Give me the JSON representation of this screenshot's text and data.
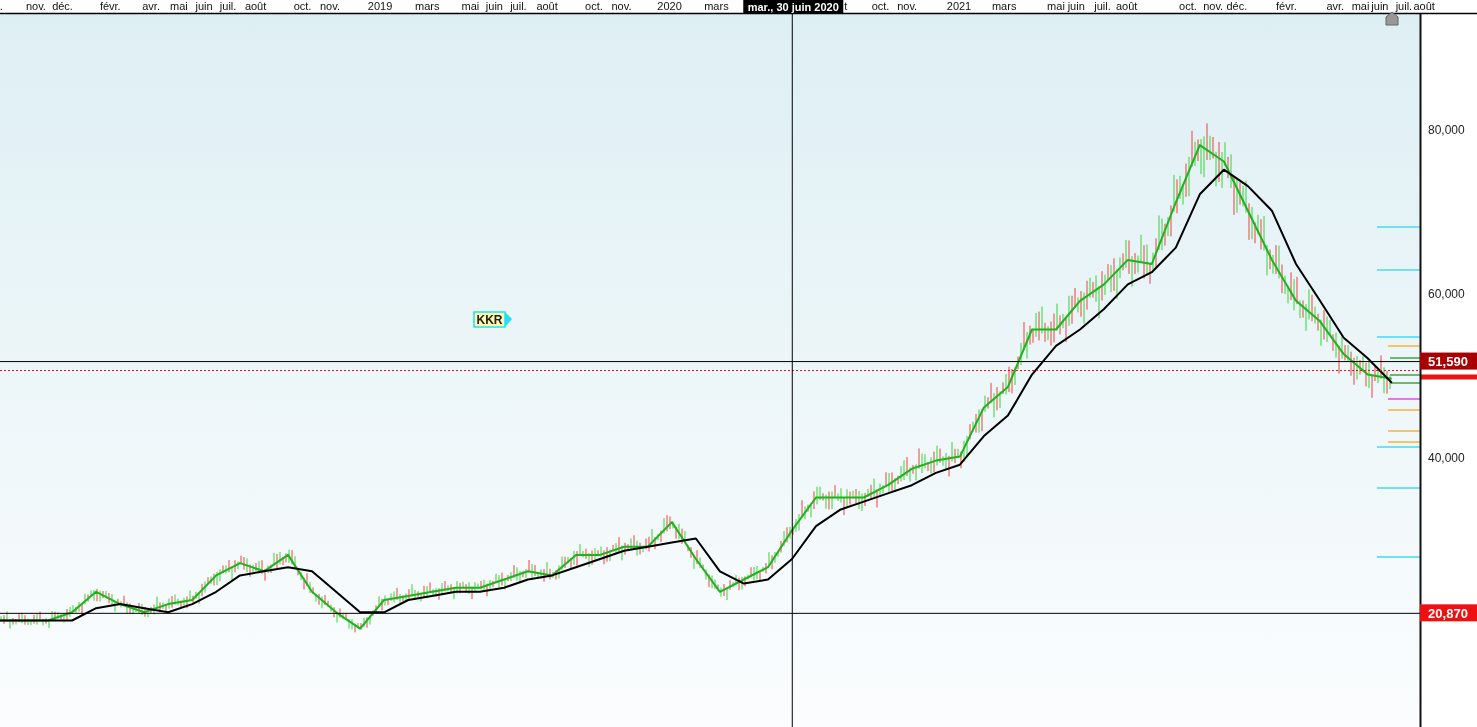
{
  "chart": {
    "chart_data": {
      "type": "line",
      "x": [
        2017.687,
        2017.77,
        2017.853,
        2017.936,
        2018.019,
        2018.102,
        2018.185,
        2018.268,
        2018.351,
        2018.434,
        2018.516,
        2018.599,
        2018.682,
        2018.765,
        2018.848,
        2018.931,
        2019.014,
        2019.097,
        2019.179,
        2019.262,
        2019.345,
        2019.428,
        2019.511,
        2019.594,
        2019.677,
        2019.76,
        2019.843,
        2019.925,
        2020.008,
        2020.091,
        2020.174,
        2020.257,
        2020.34,
        2020.423,
        2020.506,
        2020.589,
        2020.671,
        2020.754,
        2020.837,
        2020.92,
        2021.003,
        2021.086,
        2021.169,
        2021.252,
        2021.335,
        2021.418,
        2021.501,
        2021.583,
        2021.666,
        2021.749,
        2021.832,
        2021.915,
        2021.998,
        2022.081,
        2022.164,
        2022.247,
        2022.329,
        2022.412,
        2022.495
      ],
      "xlim": [
        2017.687,
        2022.786
      ],
      "ylim": [
        7000,
        94000
      ],
      "series": [
        {
          "color": "#1db31d",
          "values": [
            20000,
            20000,
            20000,
            21000,
            23500,
            22000,
            21000,
            22000,
            22500,
            25500,
            27000,
            26000,
            28000,
            23500,
            21000,
            19000,
            22500,
            23000,
            23500,
            24000,
            24000,
            25000,
            26000,
            25500,
            28000,
            28000,
            29000,
            29000,
            32000,
            27500,
            23500,
            25000,
            26500,
            31000,
            35000,
            35000,
            35000,
            36500,
            38500,
            39500,
            40000,
            46000,
            48500,
            55500,
            55500,
            59000,
            61000,
            64000,
            63500,
            71000,
            78000,
            76000,
            70000,
            64000,
            59000,
            56500,
            52500,
            50000,
            49500
          ]
        },
        {
          "color": "#000000",
          "values": [
            20000,
            20000,
            20000,
            20000,
            21500,
            22000,
            21500,
            21000,
            22000,
            23500,
            25500,
            26000,
            26500,
            26000,
            23500,
            21000,
            21000,
            22500,
            23000,
            23500,
            23500,
            24000,
            25000,
            25500,
            26500,
            27500,
            28500,
            29000,
            29500,
            30000,
            26000,
            24500,
            25000,
            27500,
            31500,
            33500,
            34500,
            35500,
            36500,
            38000,
            39000,
            42500,
            45000,
            50000,
            53500,
            55500,
            58000,
            61000,
            62500,
            65500,
            72000,
            75000,
            73000,
            70000,
            63500,
            59000,
            54500,
            52000,
            49000
          ]
        }
      ],
      "xticks": [
        {
          "value": 2017.691,
          "label": "."
        },
        {
          "value": 2017.811,
          "label": "nov."
        },
        {
          "value": 2017.903,
          "label": "déc."
        },
        {
          "value": 2018.068,
          "label": "févr."
        },
        {
          "value": 2018.209,
          "label": "avr."
        },
        {
          "value": 2018.305,
          "label": "mai"
        },
        {
          "value": 2018.392,
          "label": "juin"
        },
        {
          "value": 2018.475,
          "label": "juil."
        },
        {
          "value": 2018.57,
          "label": "août"
        },
        {
          "value": 2018.732,
          "label": "oct."
        },
        {
          "value": 2018.827,
          "label": "nov."
        },
        {
          "value": 2019,
          "label": "2019"
        },
        {
          "value": 2019.163,
          "label": "mars"
        },
        {
          "value": 2019.312,
          "label": "mai"
        },
        {
          "value": 2019.395,
          "label": "juin"
        },
        {
          "value": 2019.478,
          "label": "juil."
        },
        {
          "value": 2019.577,
          "label": "août"
        },
        {
          "value": 2019.739,
          "label": "oct."
        },
        {
          "value": 2019.834,
          "label": "nov."
        },
        {
          "value": 2020,
          "label": "2020"
        },
        {
          "value": 2020.162,
          "label": "mars"
        },
        {
          "value": 2020.609,
          "label": "t"
        },
        {
          "value": 2020.729,
          "label": "oct."
        },
        {
          "value": 2020.821,
          "label": "nov."
        },
        {
          "value": 2021,
          "label": "2021"
        },
        {
          "value": 2021.156,
          "label": "mars"
        },
        {
          "value": 2021.335,
          "label": "mai"
        },
        {
          "value": 2021.405,
          "label": "juin"
        },
        {
          "value": 2021.496,
          "label": "juil."
        },
        {
          "value": 2021.579,
          "label": "août"
        },
        {
          "value": 2021.791,
          "label": "oct."
        },
        {
          "value": 2021.878,
          "label": "nov."
        },
        {
          "value": 2021.96,
          "label": "déc."
        },
        {
          "value": 2022.131,
          "label": "févr."
        },
        {
          "value": 2022.3,
          "label": "avr."
        },
        {
          "value": 2022.387,
          "label": "mai"
        },
        {
          "value": 2022.454,
          "label": "juin"
        },
        {
          "value": 2022.537,
          "label": "juil."
        },
        {
          "value": 2022.607,
          "label": "août"
        }
      ],
      "yticks": [
        {
          "value": 80000,
          "label": "80,000"
        },
        {
          "value": 60000,
          "label": "60,000"
        },
        {
          "value": 40000,
          "label": "40,000"
        }
      ],
      "ref_lines": [
        {
          "axis": "y",
          "value": 51590,
          "color": "#000000"
        },
        {
          "axis": "y",
          "value": 20870,
          "color": "#000000"
        },
        {
          "axis": "y",
          "value": 50500,
          "color": "#ee1111"
        },
        {
          "axis": "x",
          "value": 2020.424,
          "color": "#000000"
        }
      ]
    }
  },
  "price_tags": [
    {
      "label": "51,590",
      "color": "#a80000"
    },
    {
      "label": "20,870",
      "color": "#ee1111"
    }
  ],
  "crosshair": {
    "date_label": "mar., 30 juin 2020"
  },
  "symbol_tag": {
    "label": "KKR"
  }
}
